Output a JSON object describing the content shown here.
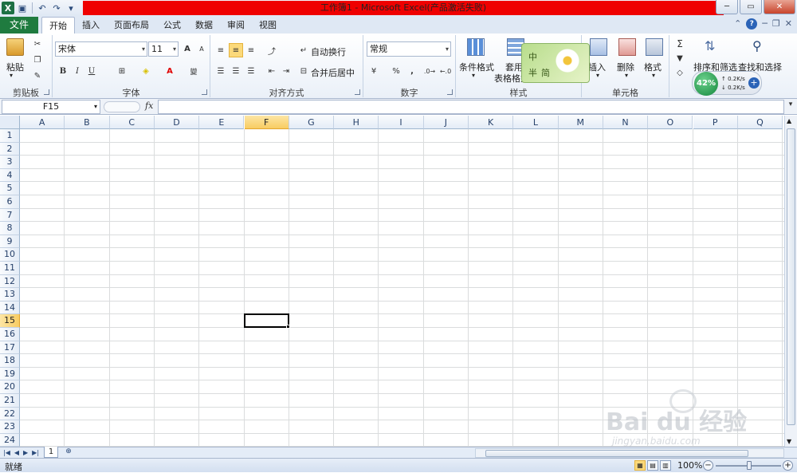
{
  "window": {
    "title": "工作簿1 - Microsoft Excel(产品激活失败)",
    "quick_access": [
      "save-icon",
      "undo-icon",
      "redo-icon",
      "customize-icon"
    ],
    "controls": {
      "minimize": "─",
      "maximize": "▭",
      "close": "✕"
    }
  },
  "tabs": {
    "file": "文件",
    "items": [
      "开始",
      "插入",
      "页面布局",
      "公式",
      "数据",
      "审阅",
      "视图"
    ],
    "active": "开始"
  },
  "ribbon": {
    "clipboard": {
      "label": "剪贴板",
      "paste": "粘贴"
    },
    "font": {
      "label": "字体",
      "name": "宋体",
      "size": "11",
      "bold": "B",
      "italic": "I",
      "underline": "U",
      "grow": "A",
      "shrink": "A",
      "wen": "變"
    },
    "alignment": {
      "label": "对齐方式",
      "wrap": "自动换行",
      "merge": "合并后居中"
    },
    "number": {
      "label": "数字",
      "format": "常规",
      "percent": "%",
      "comma": ","
    },
    "styles": {
      "label": "样式",
      "conditional": "条件格式",
      "table_format_1": "套用",
      "table_format_2": "表格格式"
    },
    "cells": {
      "label": "单元格",
      "insert": "插入",
      "delete": "删除",
      "format": "格式"
    },
    "editing": {
      "sum": "Σ",
      "sort": "排序和筛选",
      "find": "查找和选择"
    }
  },
  "formula_bar": {
    "name_box": "F15",
    "fx": "fx",
    "content": ""
  },
  "grid": {
    "columns": [
      "A",
      "B",
      "C",
      "D",
      "E",
      "F",
      "G",
      "H",
      "I",
      "J",
      "K",
      "L",
      "M",
      "N",
      "O",
      "P",
      "Q"
    ],
    "rows": [
      "1",
      "2",
      "3",
      "4",
      "5",
      "6",
      "7",
      "8",
      "9",
      "10",
      "11",
      "12",
      "13",
      "14",
      "15",
      "16",
      "17",
      "18",
      "19",
      "20",
      "21",
      "22",
      "23",
      "24"
    ],
    "active_column": "F",
    "active_row": "15"
  },
  "sheets": {
    "tabs": [
      "1"
    ]
  },
  "status": {
    "ready": "就绪",
    "zoom": "100%"
  },
  "ime_widget": {
    "chars": [
      "中",
      "半",
      "简"
    ]
  },
  "net_monitor": {
    "percent": "42%",
    "up": "0.2K/s",
    "down": "0.2K/s"
  },
  "watermark": {
    "logo": "Bai du 经验",
    "url": "jingyan.baidu.com"
  },
  "colors": {
    "title_accent": "#ef0000",
    "file_tab": "#1f7b3f",
    "selection": "#f8cc62"
  }
}
